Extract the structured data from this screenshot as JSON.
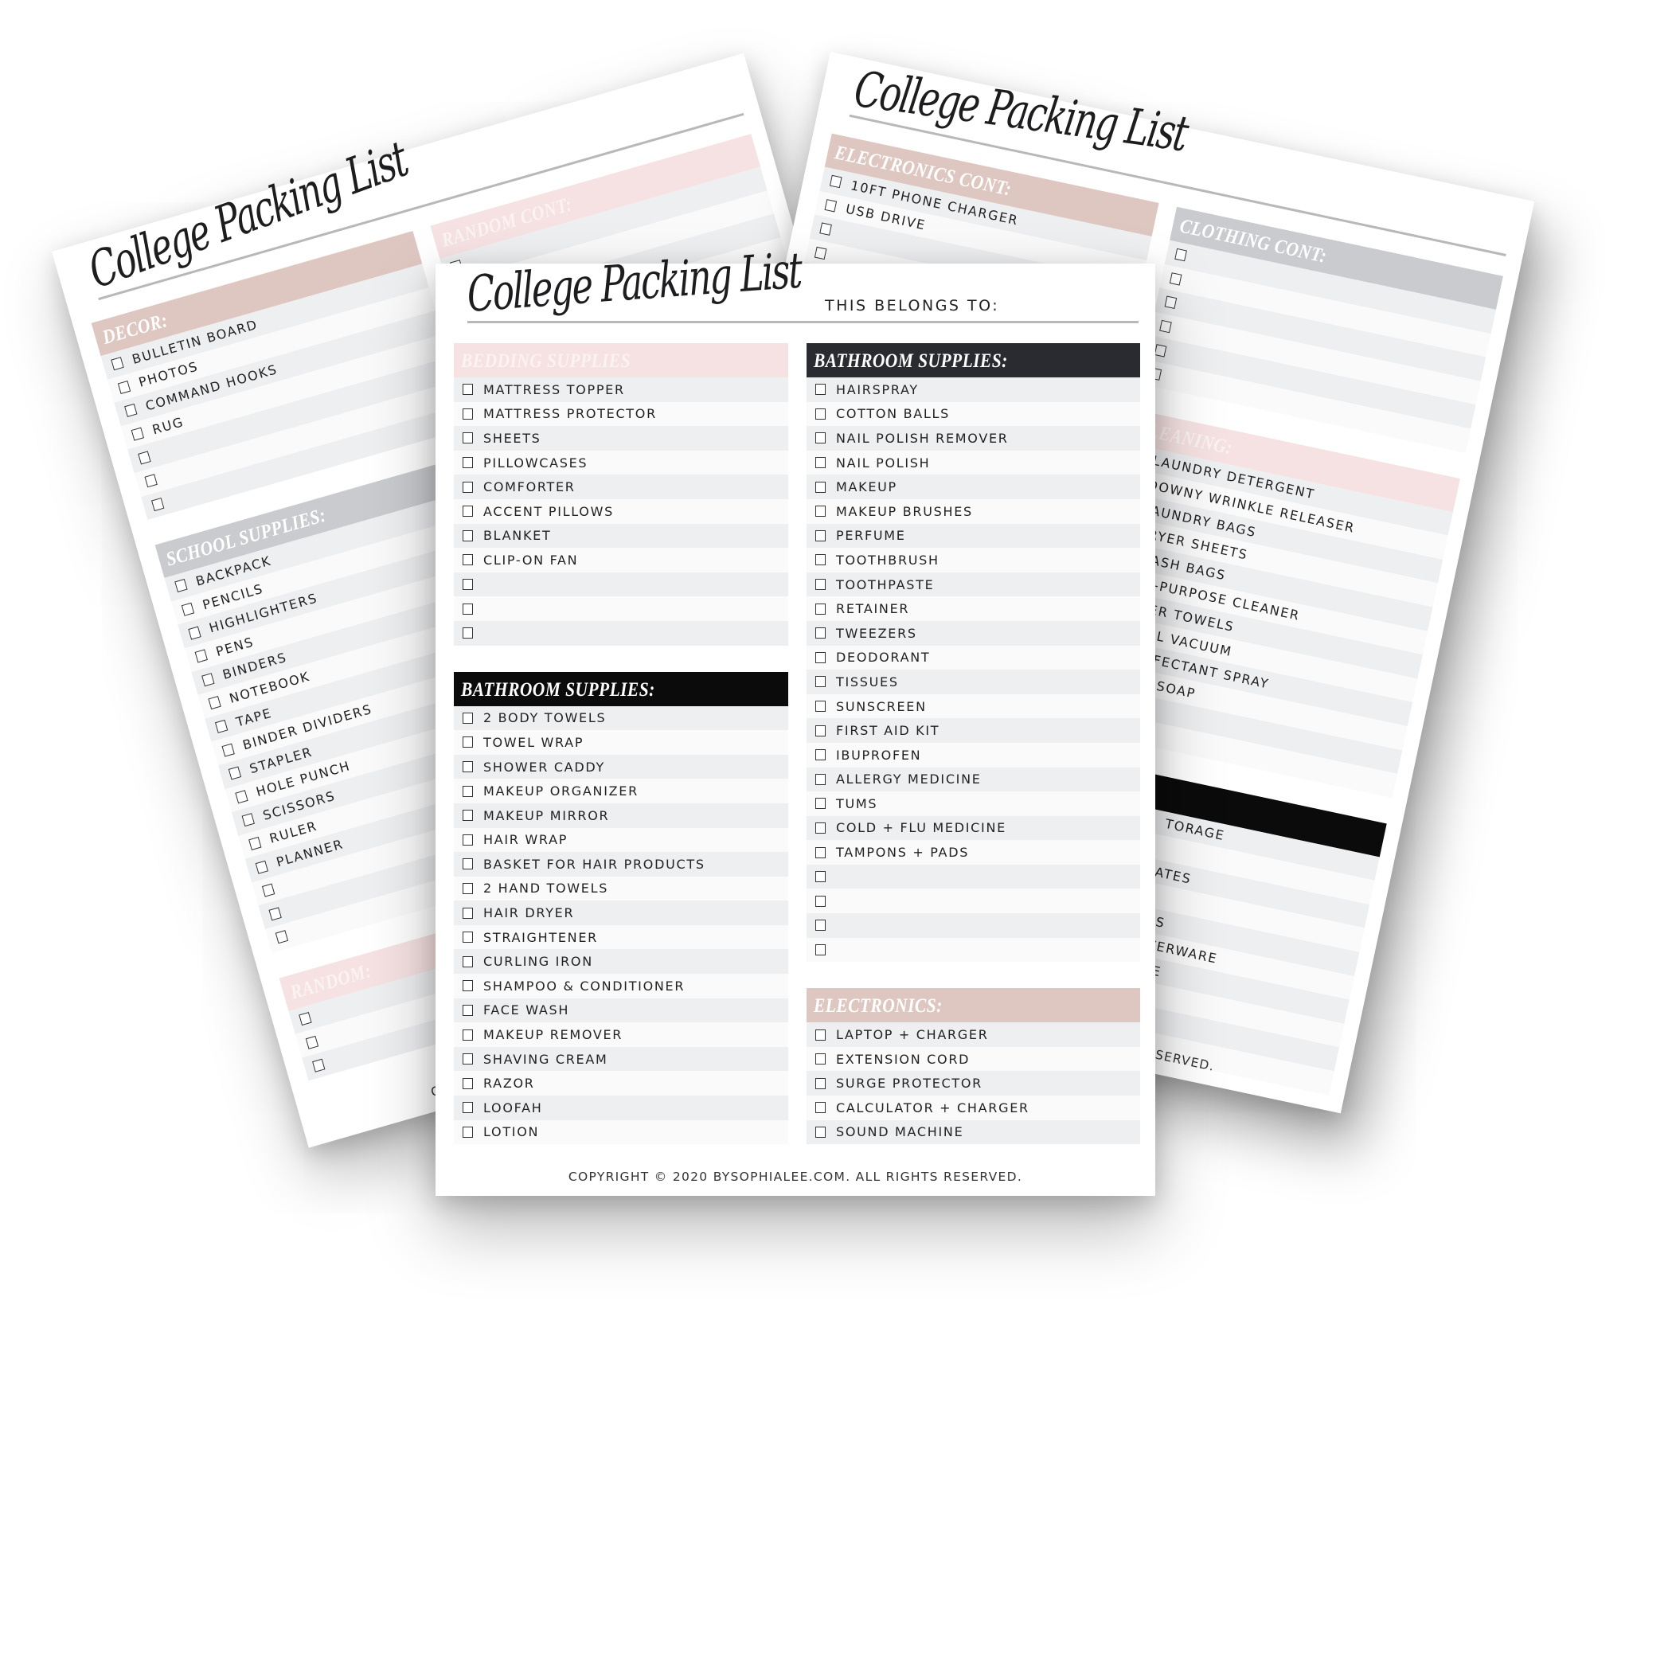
{
  "colors": {
    "pink": "#f6e2e2",
    "rose": "#dfc7c1",
    "dark": "#2a2b31",
    "black": "#0b0b0b",
    "gray": "#c9cbce",
    "row_alt": "#eeeff1"
  },
  "pages": {
    "back_left": {
      "title": "College Packing List",
      "copyright": "COPYRIGHT © 2020 BYSOPHIALEE.COM. ALL RIGHTS RESERVED.",
      "columns": [
        [
          {
            "title": "DECOR:",
            "style": "rose",
            "items": [
              "BULLETIN BOARD",
              "PHOTOS",
              "COMMAND HOOKS",
              "RUG",
              "",
              "",
              ""
            ]
          },
          {
            "title": "SCHOOL SUPPLIES:",
            "style": "gray",
            "items": [
              "BACKPACK",
              "PENCILS",
              "HIGHLIGHTERS",
              "PENS",
              "BINDERS",
              "NOTEBOOK",
              "TAPE",
              "BINDER DIVIDERS",
              "STAPLER",
              "HOLE PUNCH",
              "SCISSORS",
              "RULER",
              "PLANNER",
              "",
              "",
              ""
            ]
          },
          {
            "title": "RANDOM:",
            "style": "pink",
            "items": [
              "",
              "",
              ""
            ]
          }
        ],
        [
          {
            "title": "RANDOM CONT:",
            "style": "pink",
            "items": [
              "",
              "",
              "",
              "",
              "",
              "",
              "",
              "",
              "",
              "",
              "",
              "",
              "",
              "",
              "",
              "",
              "",
              "",
              "",
              "",
              "",
              "",
              "",
              ""
            ]
          }
        ]
      ]
    },
    "back_right": {
      "title": "College Packing List",
      "copyright": "COPYRIGHT © 2020 BYSOPHIALEE.COM. ALL RIGHTS RESERVED.",
      "columns": [
        [
          {
            "title": "ELECTRONICS CONT:",
            "style": "rose",
            "items": [
              "10FT PHONE CHARGER",
              "USB DRIVE",
              "",
              "",
              "",
              "",
              "",
              ""
            ]
          }
        ],
        [
          {
            "title": "CLOTHING CONT:",
            "style": "gray",
            "items": [
              "",
              "",
              "",
              "",
              "",
              ""
            ]
          },
          {
            "title": "CLEANING:",
            "style": "pink",
            "items": [
              "LAUNDRY DETERGENT",
              "DOWNY WRINKLE RELEASER",
              "LAUNDRY BAGS",
              "DRYER SHEETS",
              "TRASH BAGS",
              "ALL-PURPOSE CLEANER",
              "PAPER TOWELS",
              "SMALL VACUUM",
              "DISINFECTANT SPRAY",
              "DAWN SOAP",
              "",
              ""
            ]
          },
          {
            "title": ":",
            "style": "black frag",
            "items": [
              "TORAGE",
              "",
              "ATES",
              "",
              "GS",
              "LVERWARE",
              "TLE",
              "",
              "",
              ""
            ]
          }
        ]
      ]
    },
    "front": {
      "title": "College Packing List",
      "belongs_label": "THIS BELONGS TO:",
      "copyright": "COPYRIGHT © 2020 BYSOPHIALEE.COM. ALL RIGHTS RESERVED.",
      "columns": [
        [
          {
            "title": "BEDDING SUPPLIES",
            "style": "pink",
            "items": [
              "MATTRESS TOPPER",
              "MATTRESS PROTECTOR",
              "SHEETS",
              "PILLOWCASES",
              "COMFORTER",
              "ACCENT PILLOWS",
              "BLANKET",
              "CLIP-ON FAN",
              "",
              "",
              ""
            ]
          },
          {
            "title": "BATHROOM SUPPLIES:",
            "style": "black",
            "items": [
              "2 BODY TOWELS",
              "TOWEL WRAP",
              "SHOWER CADDY",
              "MAKEUP ORGANIZER",
              "MAKEUP MIRROR",
              "HAIR WRAP",
              "BASKET FOR HAIR PRODUCTS",
              "2 HAND TOWELS",
              "HAIR DRYER",
              "STRAIGHTENER",
              "CURLING IRON",
              "SHAMPOO & CONDITIONER",
              "FACE WASH",
              "MAKEUP REMOVER",
              "SHAVING CREAM",
              "RAZOR",
              "LOOFAH",
              "LOTION"
            ]
          }
        ],
        [
          {
            "title": "BATHROOM SUPPLIES:",
            "style": "dark",
            "items": [
              "HAIRSPRAY",
              "COTTON BALLS",
              "NAIL POLISH REMOVER",
              "NAIL POLISH",
              "MAKEUP",
              "MAKEUP BRUSHES",
              "PERFUME",
              "TOOTHBRUSH",
              "TOOTHPASTE",
              "RETAINER",
              "TWEEZERS",
              "DEODORANT",
              "TISSUES",
              "SUNSCREEN",
              "FIRST AID KIT",
              "IBUPROFEN",
              "ALLERGY MEDICINE",
              "TUMS",
              "COLD + FLU MEDICINE",
              "TAMPONS + PADS",
              "",
              "",
              "",
              ""
            ]
          },
          {
            "title": "ELECTRONICS:",
            "style": "rose",
            "items": [
              "LAPTOP + CHARGER",
              "EXTENSION CORD",
              "SURGE PROTECTOR",
              "CALCULATOR + CHARGER",
              "SOUND MACHINE"
            ]
          }
        ]
      ]
    }
  }
}
